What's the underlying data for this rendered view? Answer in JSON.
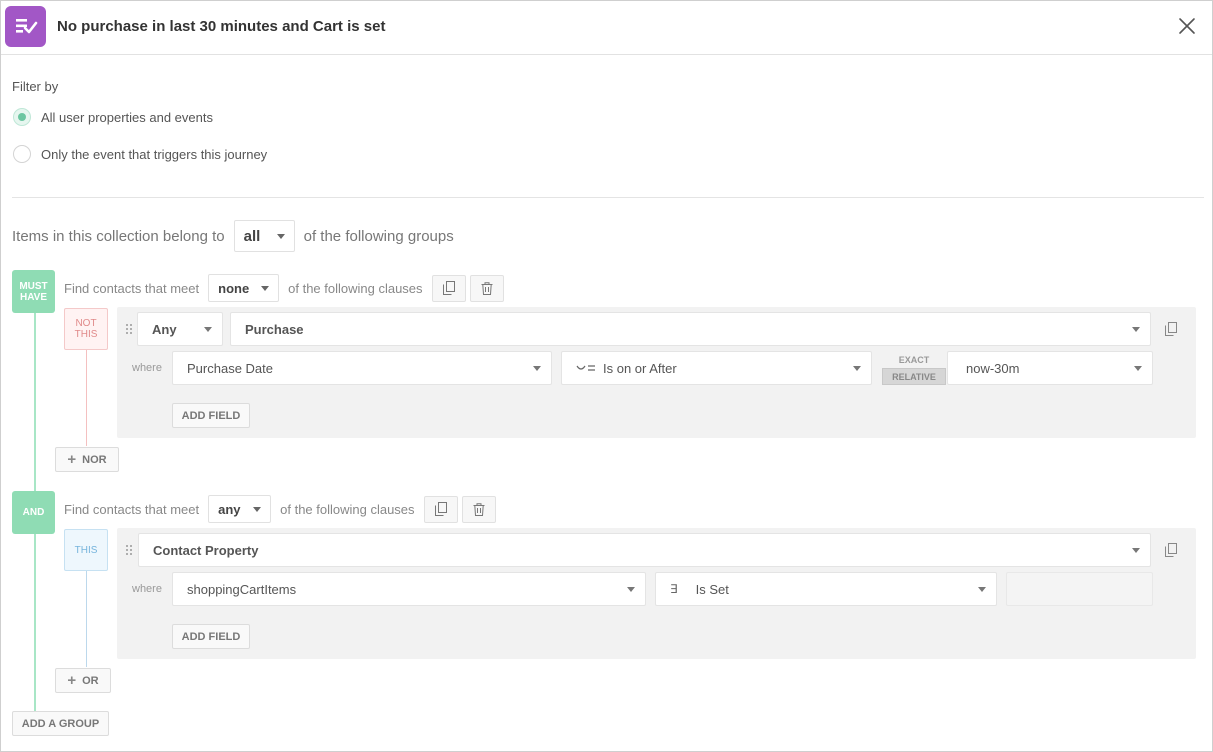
{
  "header": {
    "title": "No purchase in last 30 minutes and Cart is set",
    "app_icon": "journey-check-icon",
    "close_icon": "close-icon",
    "accent_color": "#a257c6"
  },
  "filter": {
    "label": "Filter by",
    "options": [
      {
        "label": "All user properties and events",
        "checked": true
      },
      {
        "label": "Only the event that triggers this journey",
        "checked": false
      }
    ]
  },
  "collection": {
    "prefix": "Items in this collection belong to",
    "selected": "all",
    "suffix": "of the following groups"
  },
  "groups": [
    {
      "badge": "MUST HAVE",
      "header_prefix": "Find contacts that meet",
      "match": "none",
      "header_suffix": "of the following clauses",
      "clause_badge": "NOT THIS",
      "quantifier": "Any",
      "event": "Purchase",
      "where_label": "where",
      "field": "Purchase Date",
      "operator_icon": "date-after-icon",
      "operator": "Is on or After",
      "toggle_exact": "EXACT",
      "toggle_relative": "RELATIVE",
      "value": "now-30m",
      "add_field": "ADD FIELD",
      "add_clause": "NOR"
    },
    {
      "badge": "AND",
      "header_prefix": "Find contacts that meet",
      "match": "any",
      "header_suffix": "of the following clauses",
      "clause_badge": "THIS",
      "event": "Contact Property",
      "where_label": "where",
      "field": "shoppingCartItems",
      "operator_icon": "exists-icon",
      "operator_symbol": "∃",
      "operator": "Is Set",
      "add_field": "ADD FIELD",
      "add_clause": "OR"
    }
  ],
  "add_group": "ADD A GROUP"
}
